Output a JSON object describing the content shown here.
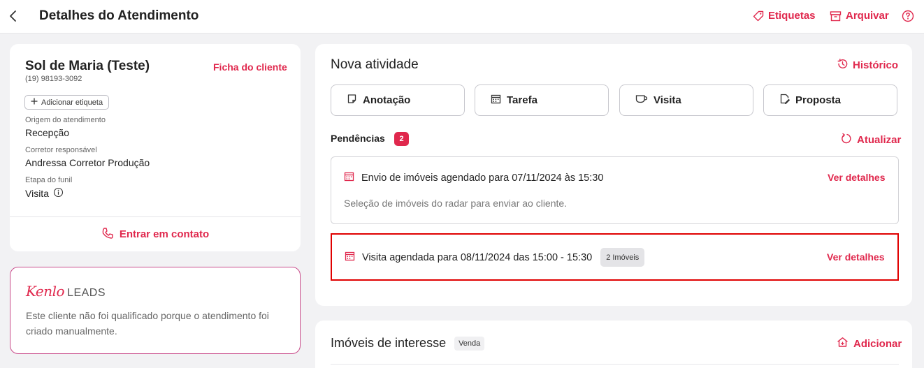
{
  "header": {
    "title": "Detalhes do Atendimento",
    "etiquetas_label": "Etiquetas",
    "arquivar_label": "Arquivar"
  },
  "client": {
    "name": "Sol de Maria (Teste)",
    "phone": "(19) 98193-3092",
    "ficha_label": "Ficha do cliente",
    "add_tag_label": "Adicionar etiqueta",
    "fields": [
      {
        "label": "Origem do atendimento",
        "value": "Recepção"
      },
      {
        "label": "Corretor responsável",
        "value": "Andressa Corretor Produção"
      },
      {
        "label": "Etapa do funil",
        "value": "Visita"
      }
    ],
    "contact_label": "Entrar em contato"
  },
  "leads": {
    "brand": "Kenlo",
    "brand_suffix": "LEADS",
    "text": "Este cliente não foi qualificado porque o atendimento foi criado manualmente."
  },
  "activity": {
    "title": "Nova atividade",
    "historico_label": "Histórico",
    "buttons": [
      {
        "label": "Anotação",
        "icon": "note-icon"
      },
      {
        "label": "Tarefa",
        "icon": "calendar-icon"
      },
      {
        "label": "Visita",
        "icon": "cup-icon"
      },
      {
        "label": "Proposta",
        "icon": "document-edit-icon"
      }
    ],
    "pendencias_label": "Pendências",
    "pendencias_count": "2",
    "atualizar_label": "Atualizar",
    "items": [
      {
        "title": "Envio de imóveis agendado para 07/11/2024 às 15:30",
        "description": "Seleção de imóveis do radar para enviar ao cliente.",
        "action": "Ver detalhes"
      },
      {
        "title": "Visita agendada para 08/11/2024 das 15:00 - 15:30",
        "chip": "2 Imóveis",
        "action": "Ver detalhes"
      }
    ]
  },
  "interest": {
    "title": "Imóveis de interesse",
    "chip": "Venda",
    "add_label": "Adicionar"
  },
  "colors": {
    "accent": "#e0284d",
    "highlight_border": "#e00000",
    "leads_border": "#c94b8a"
  }
}
